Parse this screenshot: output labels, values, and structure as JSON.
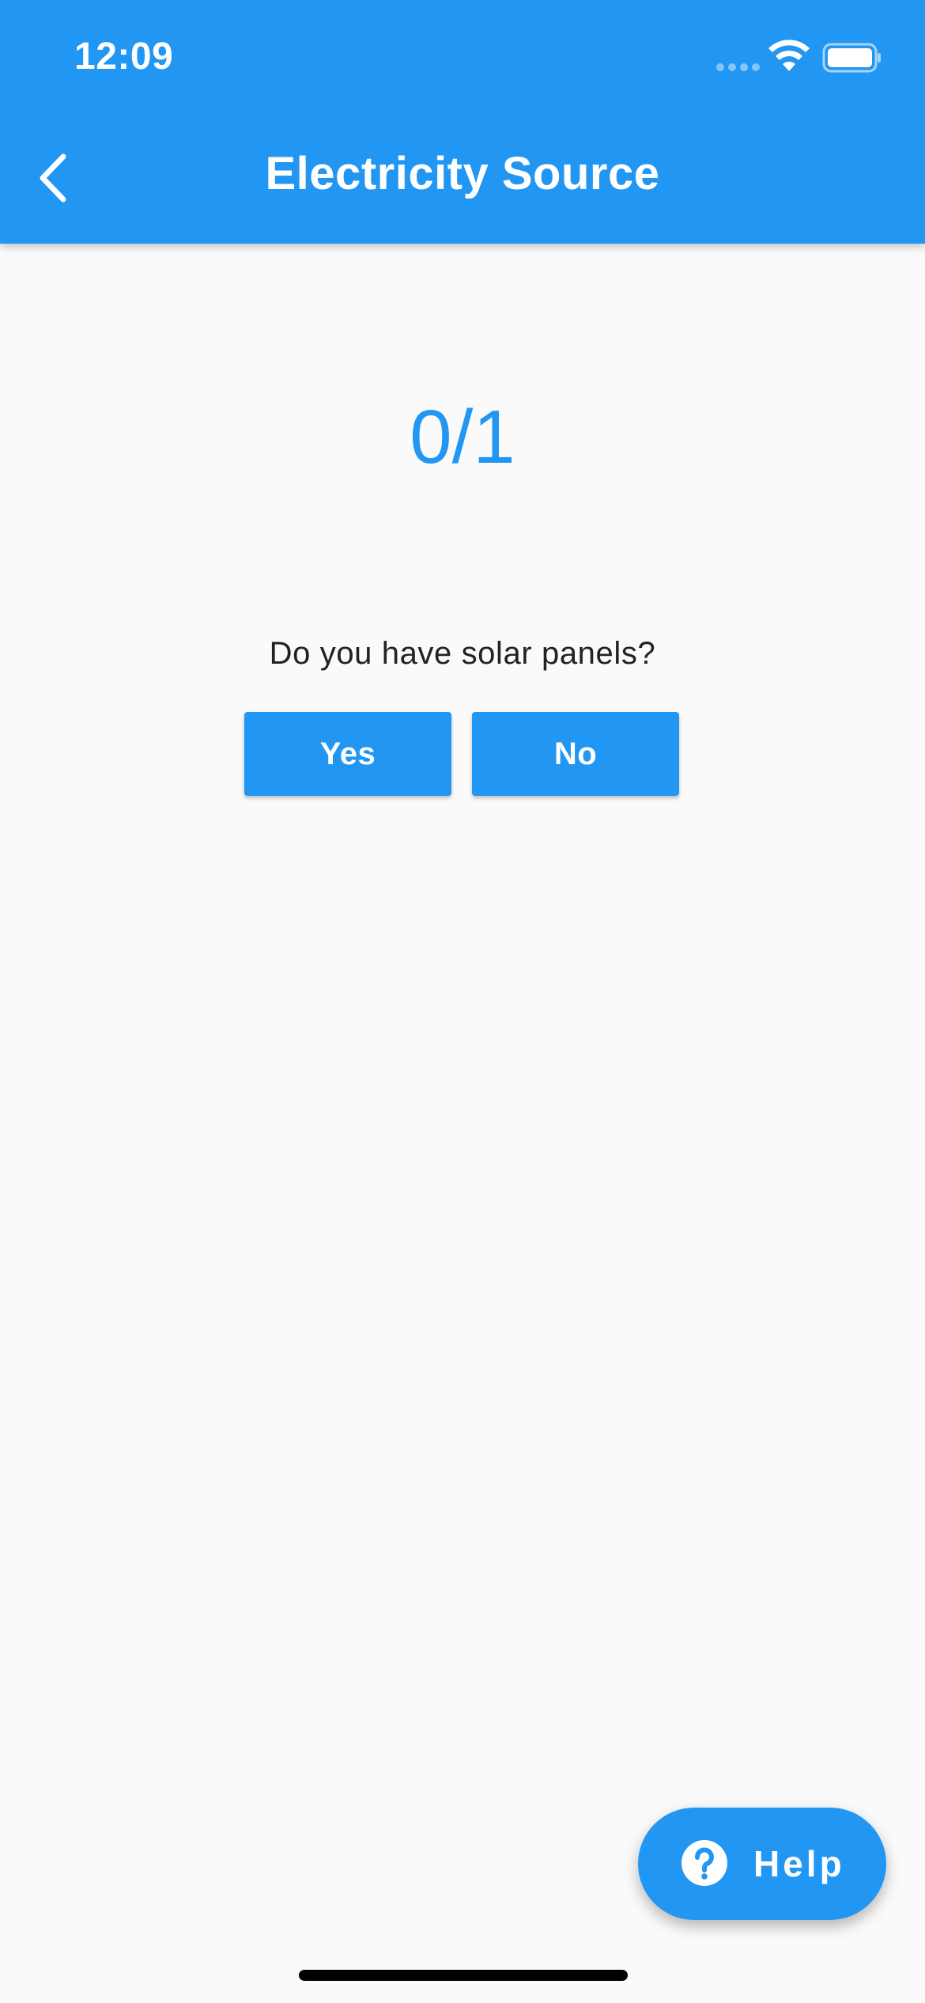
{
  "status_bar": {
    "time": "12:09",
    "wifi_icon": "wifi-icon",
    "battery_icon": "battery-icon"
  },
  "app_bar": {
    "title": "Electricity Source",
    "back_icon": "chevron-left-icon",
    "background_color": "#2196f3"
  },
  "progress": {
    "label": "0/1"
  },
  "question": {
    "text": "Do you have solar panels?",
    "answers": {
      "yes_label": "Yes",
      "no_label": "No"
    }
  },
  "help_fab": {
    "label": "Help",
    "icon": "question-circle-icon"
  },
  "colors": {
    "accent": "#2196f3",
    "background": "#fafafa",
    "text": "#222222"
  }
}
